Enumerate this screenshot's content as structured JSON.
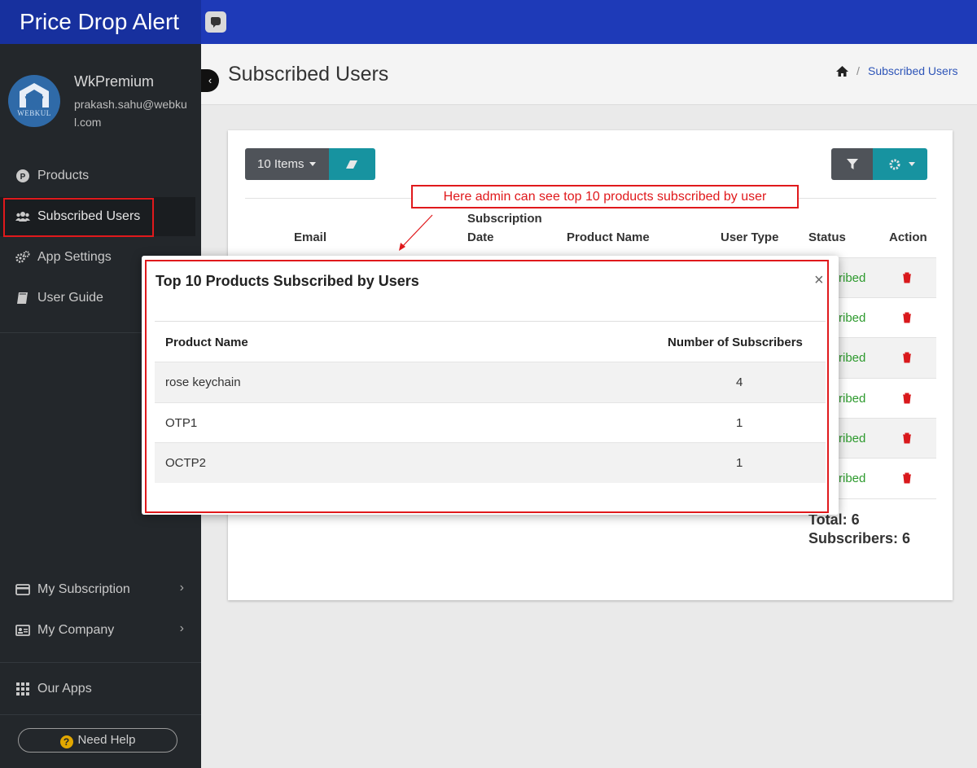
{
  "app": {
    "title": "Price Drop Alert"
  },
  "account": {
    "name": "WkPremium",
    "email": "prakash.sahu@webkul.com",
    "logo_text": "WEBKUL"
  },
  "sidebar": {
    "items": [
      {
        "label": "Products",
        "icon": "product-p-icon"
      },
      {
        "label": "Subscribed Users",
        "icon": "users-icon",
        "active": true
      },
      {
        "label": "App Settings",
        "icon": "gears-icon"
      },
      {
        "label": "User Guide",
        "icon": "book-icon"
      },
      {
        "label": "My Subscription",
        "icon": "credit-card-icon"
      },
      {
        "label": "My Company",
        "icon": "id-card-icon"
      },
      {
        "label": "Our Apps",
        "icon": "grid-icon"
      }
    ],
    "need_help": "Need Help"
  },
  "header": {
    "title": "Subscribed Users",
    "breadcrumb": "Subscribed Users"
  },
  "toolbar": {
    "items_label": "10 Items"
  },
  "table": {
    "headers": {
      "email": "Email",
      "subscription": "Subscription",
      "date": "Date",
      "product": "Product Name",
      "user_type": "User Type",
      "status": "Status",
      "action": "Action"
    },
    "status_values": [
      "ribed",
      "ribed",
      "ribed",
      "ribed",
      "ribed",
      "ribed"
    ],
    "total": "Total: 6",
    "subscribers": "Subscribers: 6"
  },
  "annotation": {
    "text": "Here admin can see top 10 products subscribed by user"
  },
  "modal": {
    "title": "Top 10 Products Subscribed by Users",
    "close": "×",
    "headers": {
      "name": "Product Name",
      "count": "Number of Subscribers"
    },
    "rows": [
      {
        "name": "rose keychain",
        "count": "4"
      },
      {
        "name": "OTP1",
        "count": "1"
      },
      {
        "name": "OCTP2",
        "count": "1"
      }
    ]
  },
  "colors": {
    "brand": "#1e3ab8",
    "sidebar": "#23272b",
    "teal": "#1793a0",
    "highlight": "#e0191c",
    "status": "#2d9a2d"
  }
}
